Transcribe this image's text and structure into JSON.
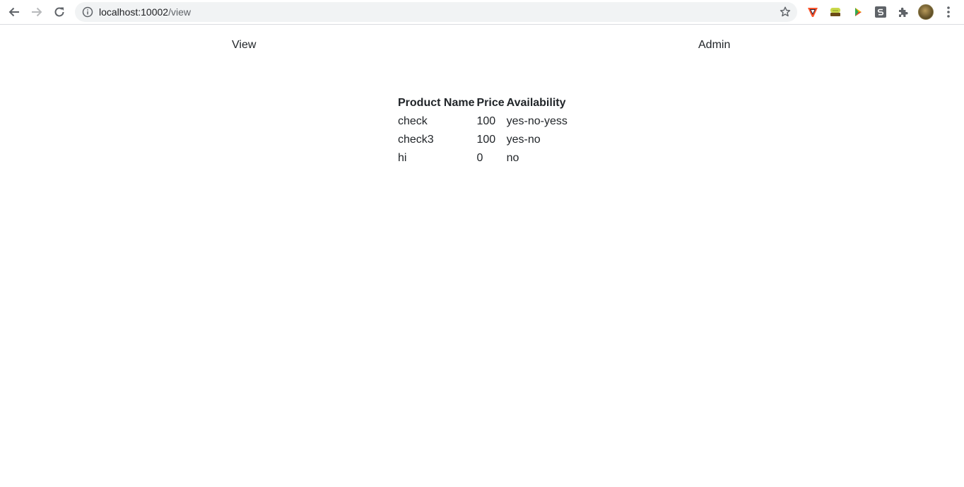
{
  "browser": {
    "url_host": "localhost:10002",
    "url_path": "/view",
    "extensions": [
      "brave-icon",
      "bread-icon",
      "play-icon",
      "s-extension-icon",
      "puzzle-icon"
    ]
  },
  "nav": {
    "view_label": "View",
    "admin_label": "Admin"
  },
  "table": {
    "headers": [
      "Product Name",
      "Price",
      "Availability"
    ],
    "rows": [
      {
        "name": "check",
        "price": "100",
        "availability": "yes-no-yess"
      },
      {
        "name": "check3",
        "price": "100",
        "availability": "yes-no"
      },
      {
        "name": "hi",
        "price": "0",
        "availability": "no"
      }
    ]
  },
  "colors": {
    "text": "#212529",
    "omnibox_bg": "#f1f3f4",
    "icon_gray": "#5f6368"
  }
}
